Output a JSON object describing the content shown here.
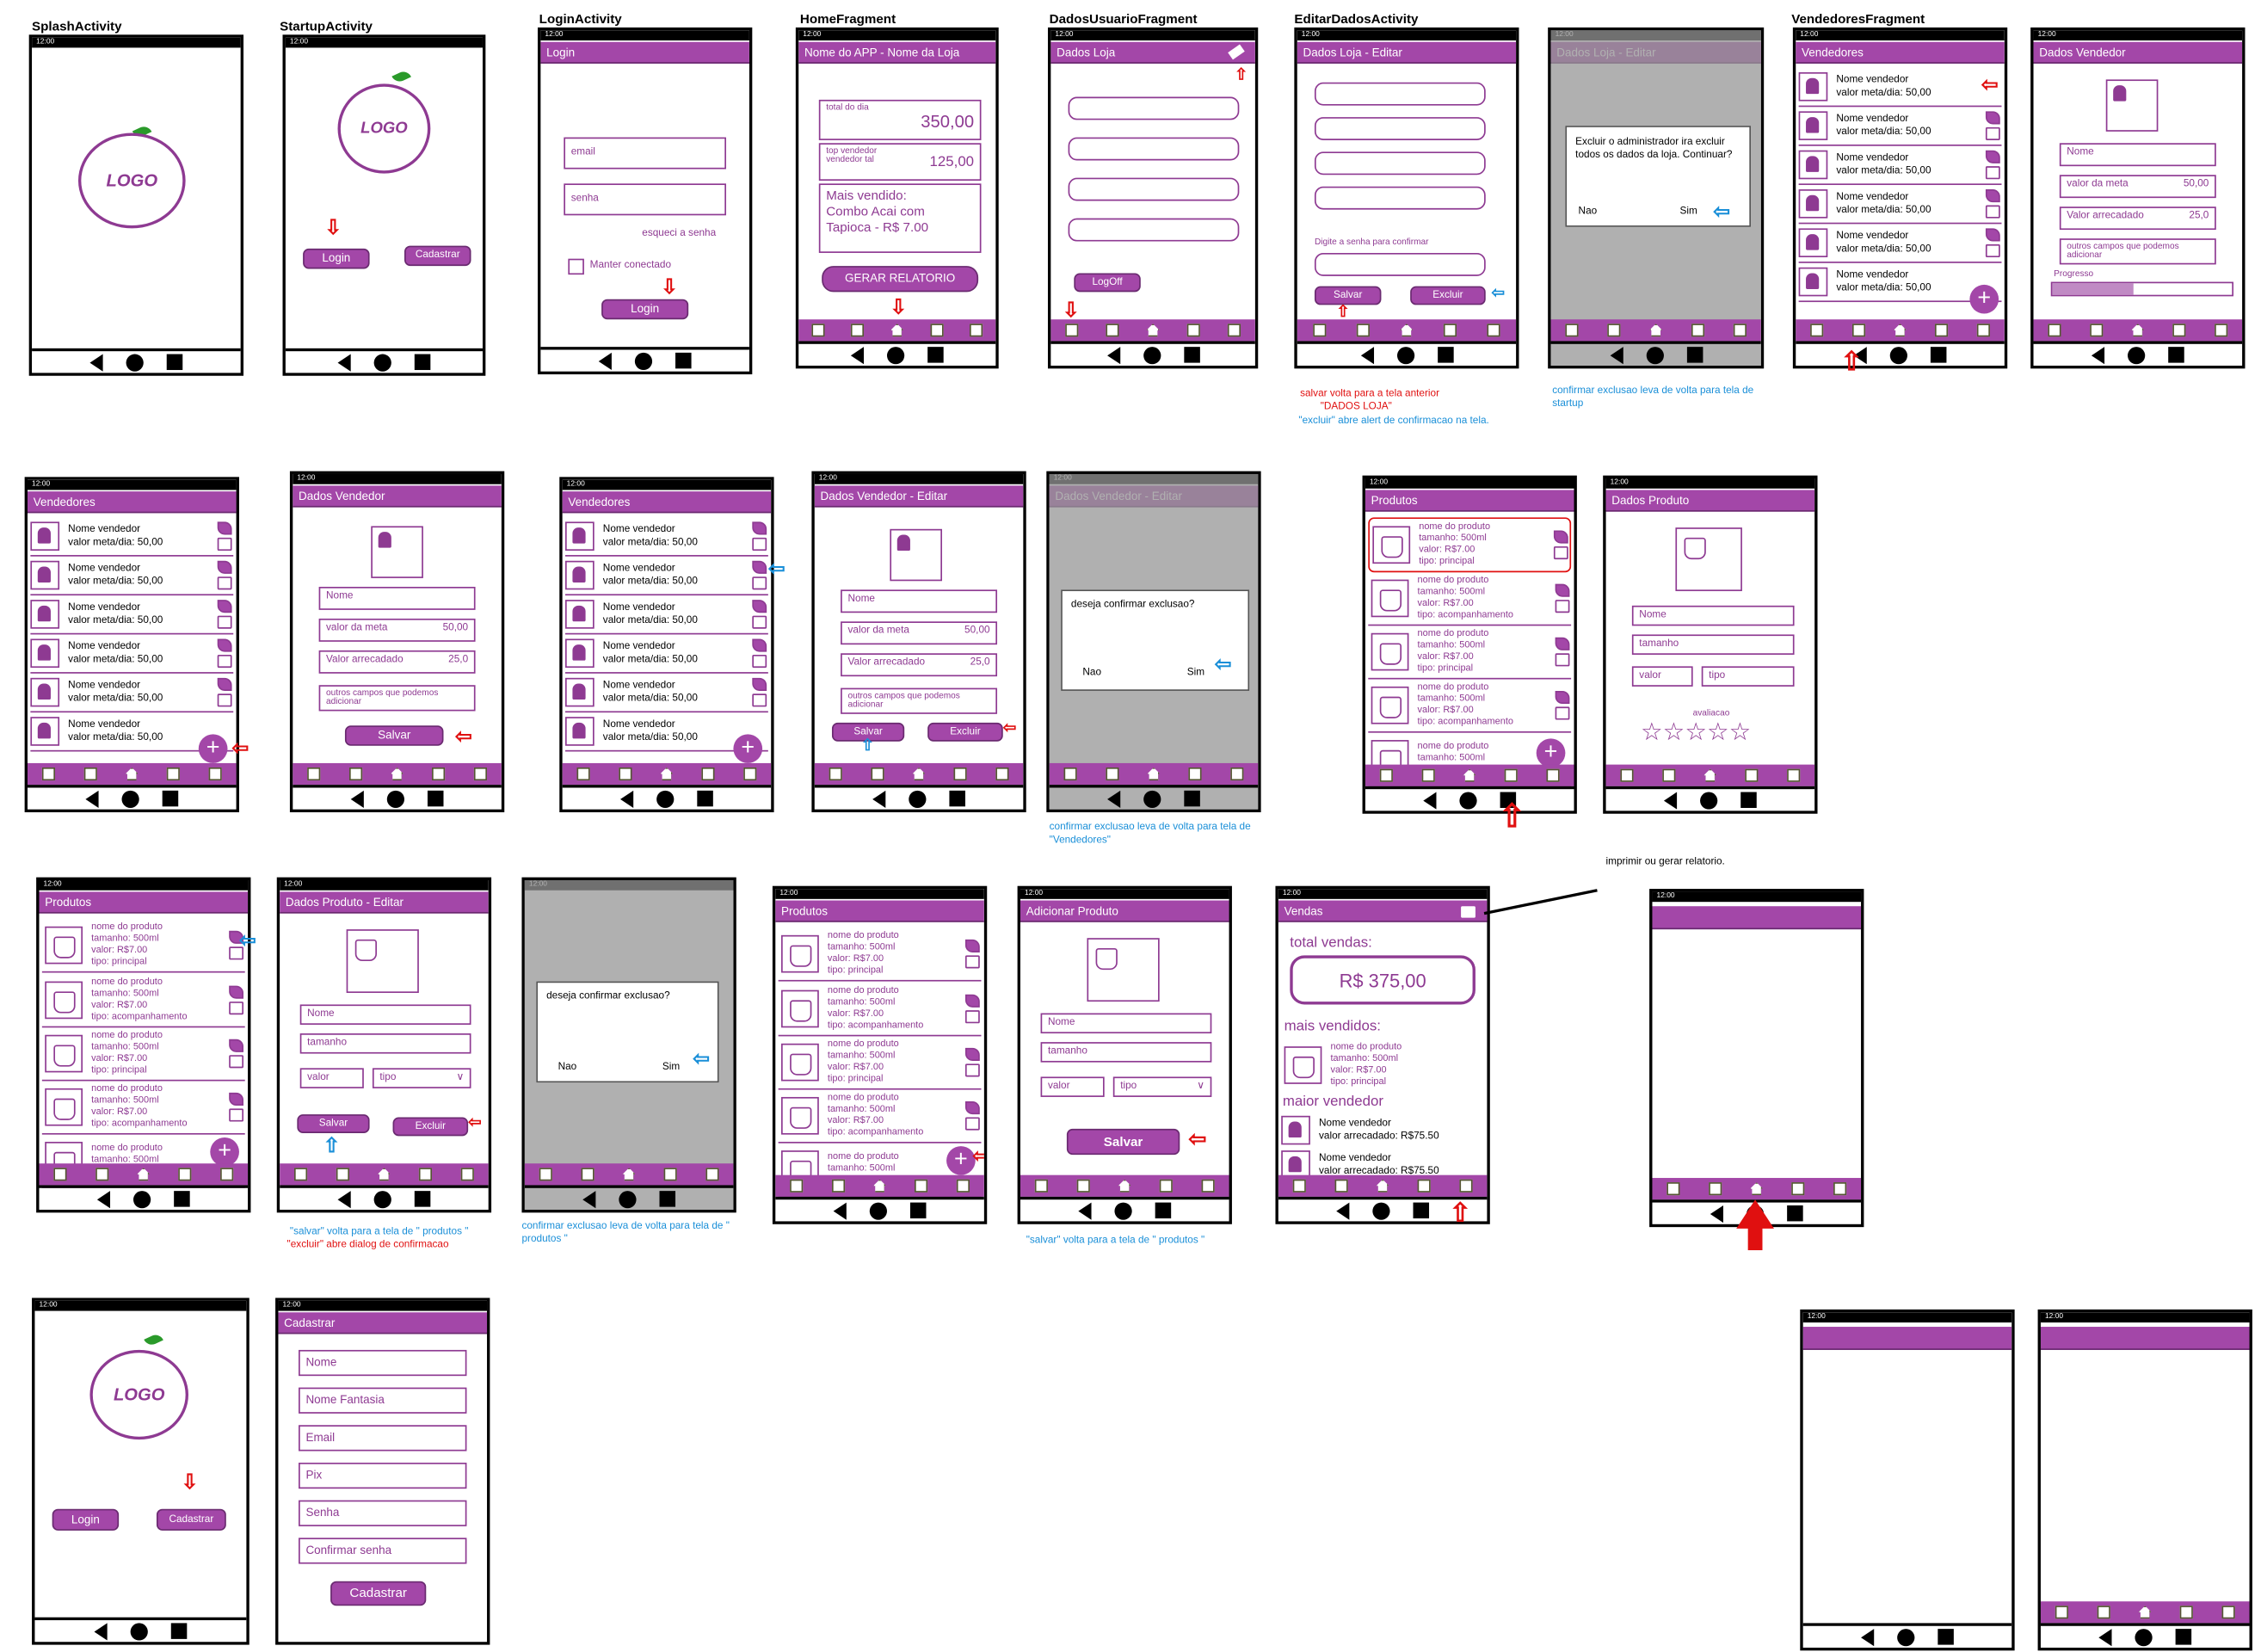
{
  "captions": {
    "splash": "SplashActivity",
    "startup": "StartupActivity",
    "login": "LoginActivity",
    "home": "HomeFragment",
    "dados_usuario": "DadosUsuarioFragment",
    "editar_dados": "EditarDadosActivity",
    "vendedores": "VendedoresFragment"
  },
  "common": {
    "time": "12:00",
    "logo": "LOGO",
    "login_btn": "Login",
    "cadastrar_btn": "Cadastrar",
    "salvar": "Salvar",
    "excluir": "Excluir",
    "nao": "Nao",
    "sim": "Sim"
  },
  "login_screen": {
    "title": "Login",
    "email_placeholder": "email",
    "senha_placeholder": "senha",
    "forgot": "esqueci a senha",
    "keep": "Manter conectado",
    "button": "Login"
  },
  "home_screen": {
    "title": "Nome do APP - Nome da Loja",
    "total_label": "total do dia",
    "total_value": "350,00",
    "top_label_1": "top vendedor",
    "top_label_2": "vendedor tal",
    "top_value": "125,00",
    "mais_label": "Mais vendido:",
    "mais_item_1": "Combo Acai com",
    "mais_item_2": "Tapioca - R$ 7.00",
    "button": "GERAR RELATORIO"
  },
  "dados_loja": {
    "title": "Dados Loja",
    "logoff": "LogOff"
  },
  "editar_loja": {
    "title": "Dados Loja - Editar",
    "confirm_hint": "Digite a senha para confirmar",
    "dialog": "Excluir o administrador ira excluir todos os dados da loja. Continuar?"
  },
  "vendedores_list": {
    "title": "Vendedores",
    "row_name": "Nome vendedor",
    "row_meta": "valor meta/dia: 50,00"
  },
  "dados_vendedor": {
    "title": "Dados Vendedor",
    "title_edit": "Dados Vendedor - Editar",
    "nome": "Nome",
    "meta_label": "valor da meta",
    "meta_value": "50,00",
    "arrecadado_label": "Valor arrecadado",
    "arrecadado_value": "25,0",
    "outros": "outros campos que podemos adicionar",
    "progresso": "Progresso",
    "dialog": "deseja confirmar exclusao?"
  },
  "produtos": {
    "title": "Produtos",
    "row_l1": "nome do produto",
    "row_l2": "tamanho: 500ml",
    "row_l3": "valor: R$7.00",
    "row_l4a": "tipo: principal",
    "row_l4b": "tipo: acompanhamento",
    "dados_title": "Dados Produto",
    "edit_title": "Dados Produto - Editar",
    "add_title": "Adicionar Produto",
    "nome": "Nome",
    "tamanho": "tamanho",
    "valor": "valor",
    "tipo": "tipo",
    "avaliacao": "avaliacao",
    "stars": "☆☆☆☆☆",
    "dialog": "deseja confirmar exclusao?"
  },
  "vendas": {
    "title": "Vendas",
    "total_label": "total vendas:",
    "total_value": "R$ 375,00",
    "mais_label": "mais vendidos:",
    "maior_label": "maior vendedor",
    "seller_name": "Nome vendedor",
    "seller_value": "valor arrecadado: R$75.50"
  },
  "cadastro": {
    "title": "Cadastrar",
    "fields": [
      "Nome",
      "Nome Fantasia",
      "Email",
      "Pix",
      "Senha",
      "Confirmar senha"
    ],
    "button": "Cadastrar"
  },
  "notes": {
    "salvar_volta": "salvar volta para a tela anterior",
    "dados_loja_q": "\"DADOS LOJA\"",
    "excluir_alert": "\"excluir\" abre alert de confirmacao na tela.",
    "confirmar_startup": "confirmar exclusao leva de volta para tela de startup",
    "confirmar_vendedores": "confirmar exclusao leva de volta para tela de \"Vendedores\"",
    "salvar_produtos": "\"salvar\" volta para a tela de \" produtos \"",
    "excluir_dialog": "\"excluir\" abre dialog de confirmacao",
    "confirmar_produtos": "confirmar exclusao leva de volta para tela de \" produtos \"",
    "salvar_produtos2": "\"salvar\" volta para a tela de \" produtos \"",
    "imprimir": "imprimir ou gerar relatorio."
  },
  "colors": {
    "accent": "#a347a8",
    "arrow_red": "#e01010",
    "arrow_blue": "#1a8fd8",
    "leaf": "#2a9a2a"
  }
}
